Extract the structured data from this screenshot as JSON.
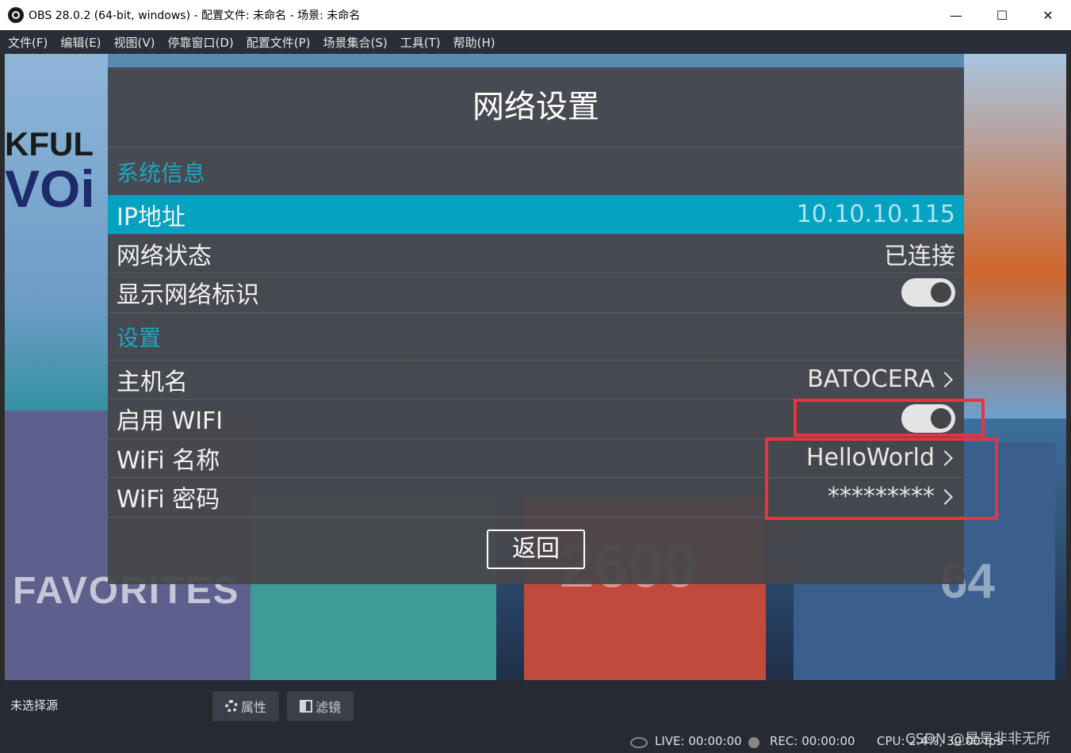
{
  "window": {
    "title": "OBS 28.0.2 (64-bit, windows) - 配置文件: 未命名 - 场景: 未命名",
    "controls": {
      "minimize": "—",
      "maximize": "☐",
      "close": "✕"
    }
  },
  "menu": [
    "文件(F)",
    "编辑(E)",
    "视图(V)",
    "停靠窗口(D)",
    "配置文件(P)",
    "场景集合(S)",
    "工具(T)",
    "帮助(H)"
  ],
  "background": {
    "kful": "KFUL",
    "voi": "VOi",
    "favorites": "FAVORITES",
    "atari": "2600",
    "commodore": "64"
  },
  "dialog": {
    "title": "网络设置",
    "section_info": "系统信息",
    "ip_label": "IP地址",
    "ip_value": "10.10.10.115",
    "status_label": "网络状态",
    "status_value": "已连接",
    "show_net_label": "显示网络标识",
    "show_net_on": true,
    "section_settings": "设置",
    "hostname_label": "主机名",
    "hostname_value": "BATOCERA",
    "wifi_enable_label": "启用 WIFI",
    "wifi_enable_on": true,
    "wifi_name_label": "WiFi 名称",
    "wifi_name_value": "HelloWorld",
    "wifi_pwd_label": "WiFi 密码",
    "wifi_pwd_value": "*********",
    "back_label": "返回"
  },
  "bottom": {
    "no_source": "未选择源",
    "properties": "属性",
    "filters": "滤镜"
  },
  "status": {
    "live": "LIVE: 00:00:00",
    "rec": "REC: 00:00:00",
    "cpu": "CPU: 2.4%, 30.00 fps"
  },
  "watermark": "CSDN @是是非非无所",
  "colors": {
    "accent": "#02a2c0",
    "section": "#1fa6c4",
    "annotation": "#e8343e"
  }
}
